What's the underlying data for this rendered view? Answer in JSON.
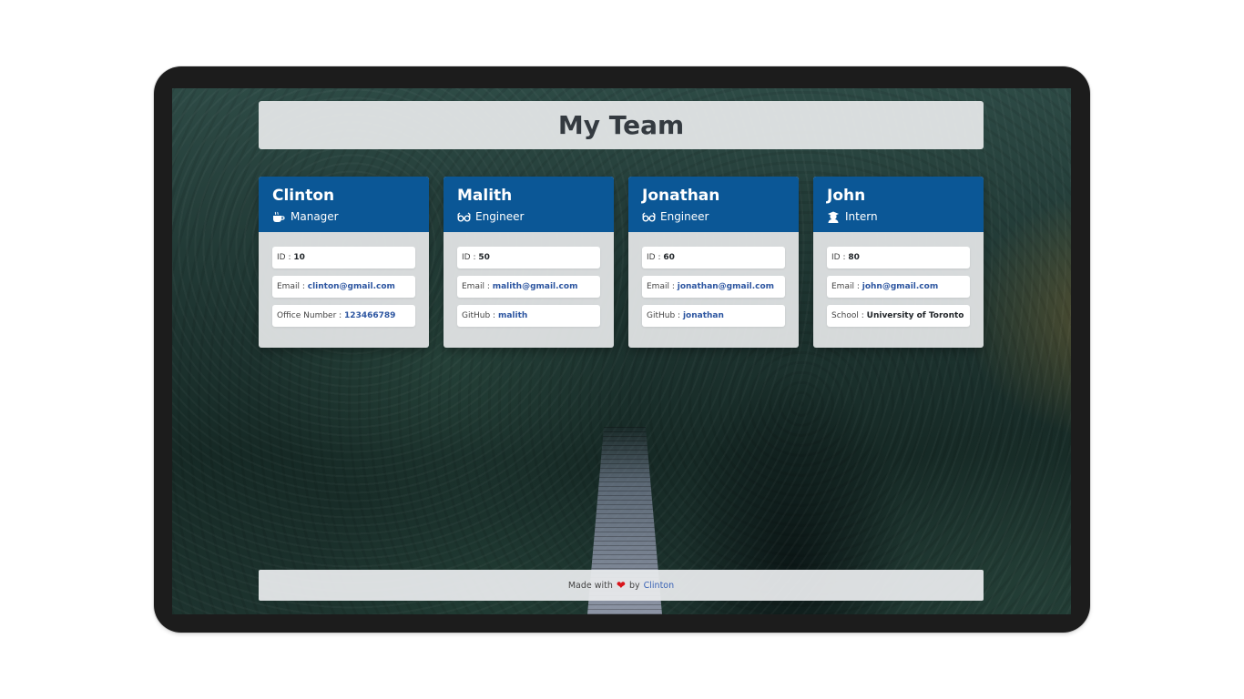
{
  "header": {
    "title": "My Team"
  },
  "colors": {
    "card_header": "#0b5796",
    "link": "#2c55a0",
    "heart": "#d9141b"
  },
  "cards": [
    {
      "name": "Clinton",
      "role": "Manager",
      "role_icon": "coffee-icon",
      "rows": [
        {
          "label": "ID : ",
          "value": "10"
        },
        {
          "label": "Email : ",
          "value": "clinton@gmail.com"
        },
        {
          "label": "Office Number : ",
          "value": "123466789"
        }
      ]
    },
    {
      "name": "Malith",
      "role": "Engineer",
      "role_icon": "glasses-icon",
      "rows": [
        {
          "label": "ID : ",
          "value": "50"
        },
        {
          "label": "Email : ",
          "value": "malith@gmail.com"
        },
        {
          "label": "GitHub : ",
          "value": "malith"
        }
      ]
    },
    {
      "name": "Jonathan",
      "role": "Engineer",
      "role_icon": "glasses-icon",
      "rows": [
        {
          "label": "ID : ",
          "value": "60"
        },
        {
          "label": "Email : ",
          "value": "jonathan@gmail.com"
        },
        {
          "label": "GitHub : ",
          "value": "jonathan"
        }
      ]
    },
    {
      "name": "John",
      "role": "Intern",
      "role_icon": "graduate-icon",
      "rows": [
        {
          "label": "ID : ",
          "value": "80"
        },
        {
          "label": "Email : ",
          "value": "john@gmail.com"
        },
        {
          "label": "School : ",
          "value": "University of Toronto"
        }
      ]
    }
  ],
  "footer": {
    "prefix": "Made with",
    "heart": "❤",
    "middle": "by",
    "author": "Clinton"
  }
}
